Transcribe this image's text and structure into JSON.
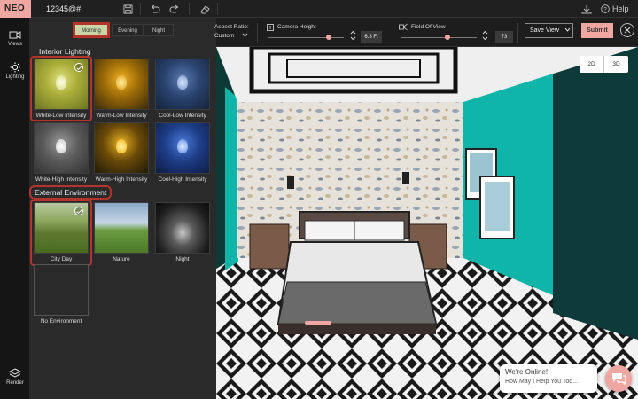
{
  "app": {
    "logo": "NEO",
    "project_name": "12345@#",
    "help_label": "Help"
  },
  "left_nav": {
    "views_label": "Views",
    "lighting_label": "Lighting",
    "render_label": "Render"
  },
  "panel": {
    "time_tabs": [
      {
        "label": "Morning",
        "active": true
      },
      {
        "label": "Evening",
        "active": false
      },
      {
        "label": "Night",
        "active": false
      }
    ],
    "interior_title": "Interior Lighting",
    "interior_options": [
      {
        "label": "White-Low Intensity",
        "selected": true
      },
      {
        "label": "Warm-Low Intensity",
        "selected": false
      },
      {
        "label": "Cool-Low Intensity",
        "selected": false
      },
      {
        "label": "White-High Intensity",
        "selected": false
      },
      {
        "label": "Warm-High Intensity",
        "selected": false
      },
      {
        "label": "Cool-High Intensity",
        "selected": false
      }
    ],
    "exterior_title": "External Environment",
    "exterior_options": [
      {
        "label": "City Day",
        "selected": true
      },
      {
        "label": "Nature",
        "selected": false
      },
      {
        "label": "Night",
        "selected": false
      },
      {
        "label": "No Environment",
        "selected": false
      }
    ]
  },
  "toolbar": {
    "aspect_label": "Aspect Ratio:",
    "aspect_value": "Custom",
    "camera_height_label": "Camera Height",
    "camera_height_value": "6.3 Ft",
    "fov_label": "Field Of View",
    "fov_value": "73",
    "save_view_label": "Save View",
    "submit_label": "Submit"
  },
  "view_toggle": {
    "option_2d": "2D",
    "option_3d": "3D"
  },
  "chat": {
    "line1": "We're Online!",
    "line2": "How May I Help You Tod..."
  },
  "colors": {
    "accent": "#f1a7a1",
    "highlight": "#b4332a",
    "teal_wall": "#0fb5a8"
  }
}
